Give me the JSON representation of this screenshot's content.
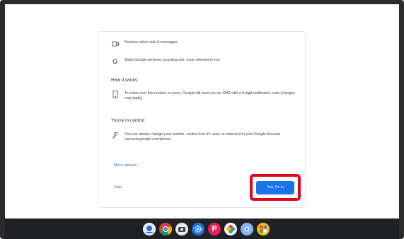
{
  "dialog": {
    "items_top": [
      {
        "icon": "video-icon",
        "text": "Receive video calls & messages"
      },
      {
        "icon": "google-g-icon",
        "text": "Make Google services, including ads, more relevant to you"
      }
    ],
    "how_it_works": {
      "title": "How it works",
      "text": "To make sure this number is yours, Google will send you an SMS with a 6-digit verification code (charges may apply)"
    },
    "in_control": {
      "title": "You're in control",
      "text": "You can always change your number, control how it's used, or remove it in your Google Account (account.google.com/phone)"
    },
    "more_options": "More options",
    "skip": "Skip",
    "yes_button": "Yes, I'm in"
  },
  "colors": {
    "accent": "#1a73e8",
    "highlight": "#e0081e",
    "shelf": "#202124"
  },
  "shelf_apps": [
    "launcher-icon",
    "chrome-icon",
    "camera-icon",
    "settings-icon",
    "app-red-icon",
    "photos-icon",
    "app-blue-icon",
    "app-grid-icon"
  ]
}
